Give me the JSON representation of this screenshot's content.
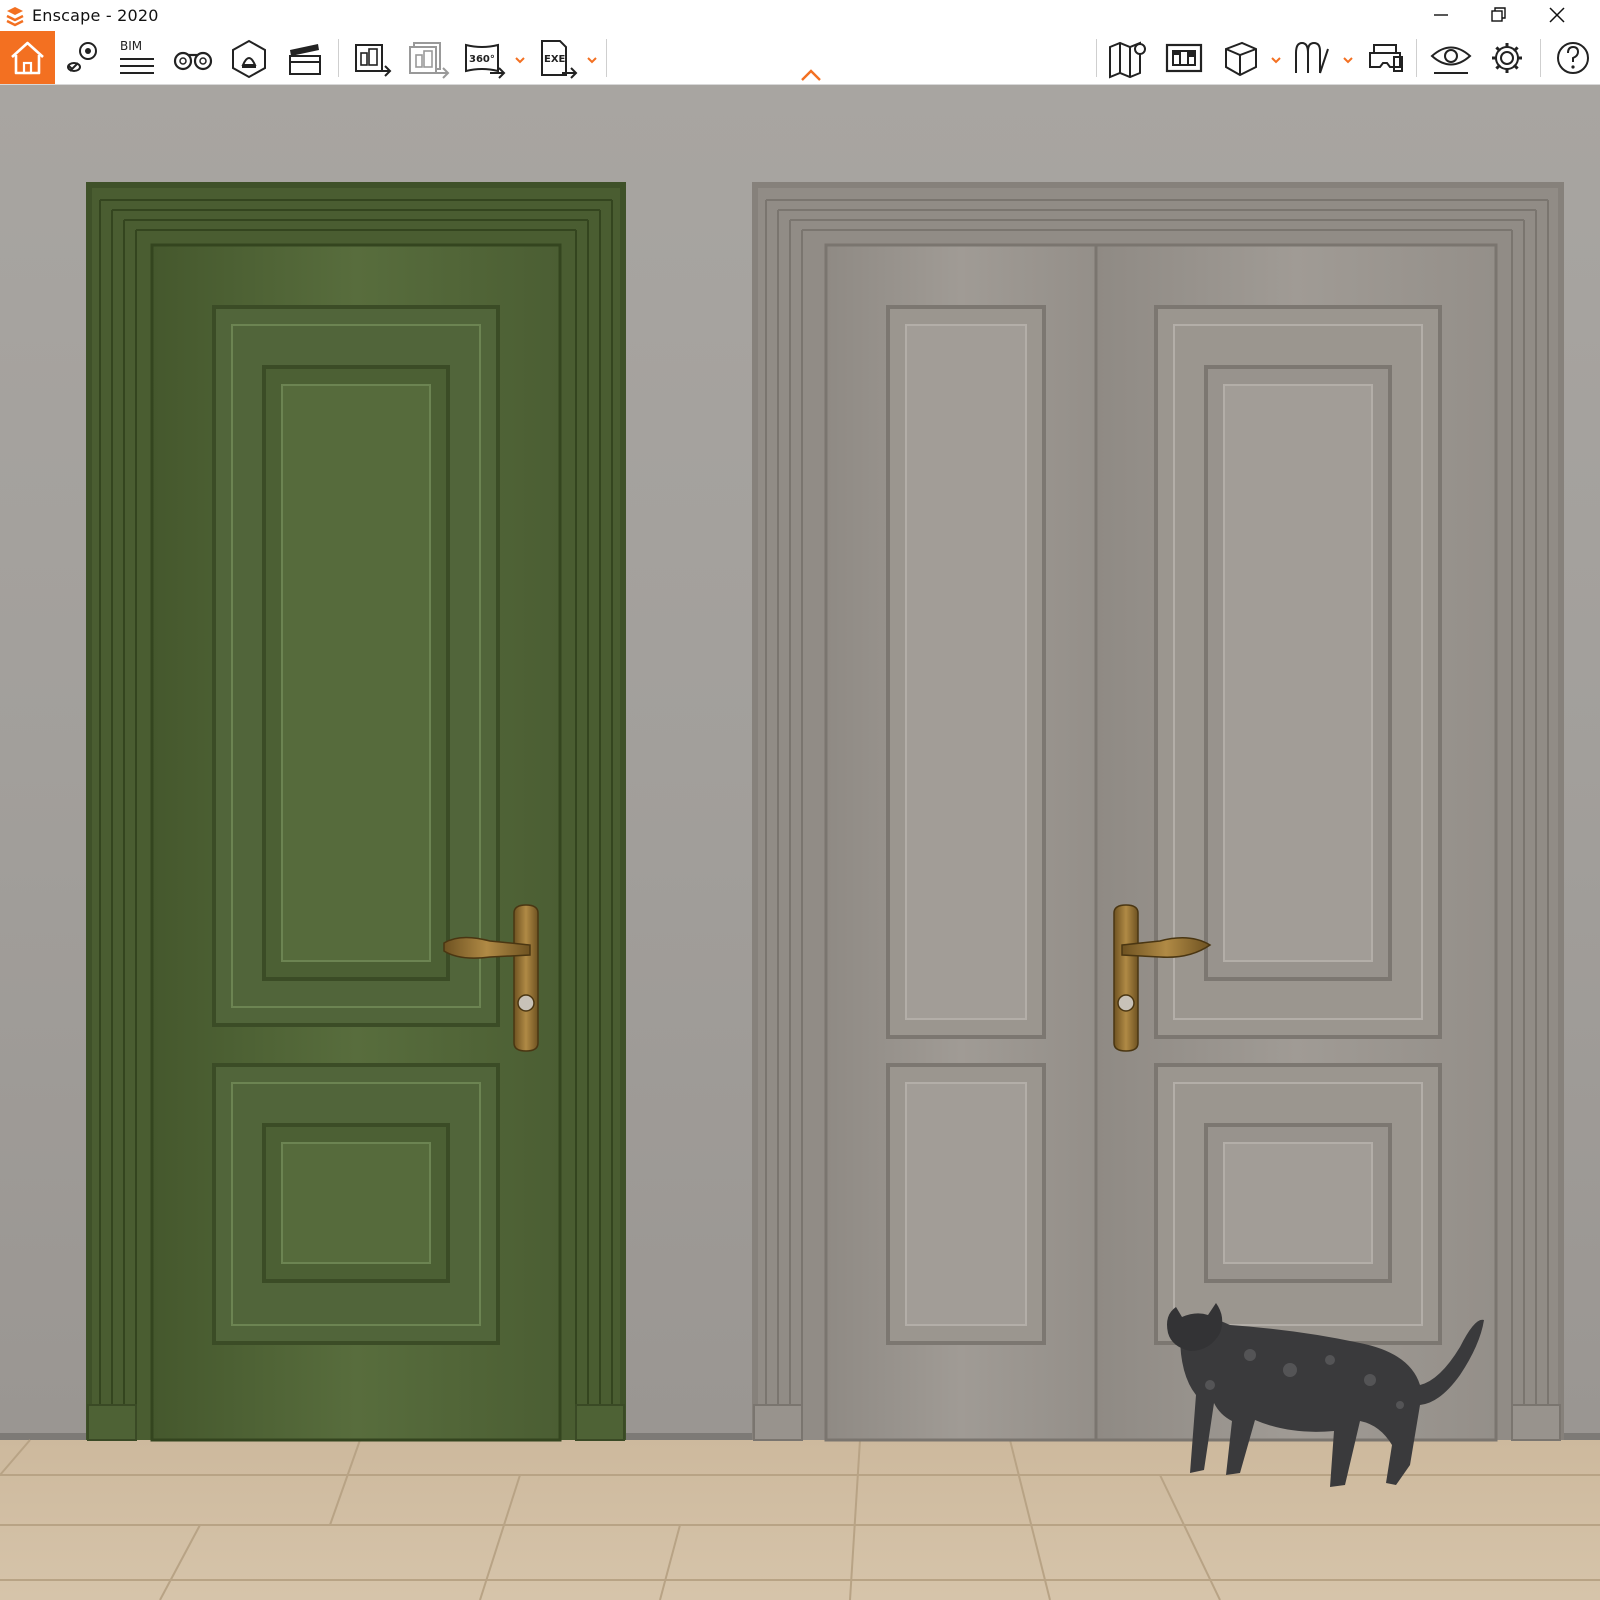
{
  "window": {
    "title": "Enscape - 2020",
    "controls": [
      "minimize",
      "restore",
      "close"
    ]
  },
  "toolbar": {
    "bim_label": "BIM",
    "panorama_label": "360°",
    "exe_label": "EXE",
    "accent_color": "#f37021",
    "left_tools": [
      "home-icon",
      "location-pin-icon",
      "bim-icon",
      "binoculars-icon",
      "light-view-icon",
      "video-clapper-icon",
      "render-image-icon",
      "batch-render-icon",
      "panorama-360-icon",
      "export-exe-icon"
    ],
    "right_tools": [
      "map-icon",
      "view-management-icon",
      "cube-icon",
      "asset-library-icon",
      "vr-headset-icon",
      "visual-settings-icon",
      "gear-icon",
      "help-icon"
    ]
  },
  "viewport": {
    "description_id": "ID:830899958",
    "colors": {
      "wall": "#a4a19e",
      "green_door": "#54693a",
      "grey_door": "#9a958f",
      "floor": "#d2bfa3",
      "handle": "#8a6a2e"
    }
  }
}
